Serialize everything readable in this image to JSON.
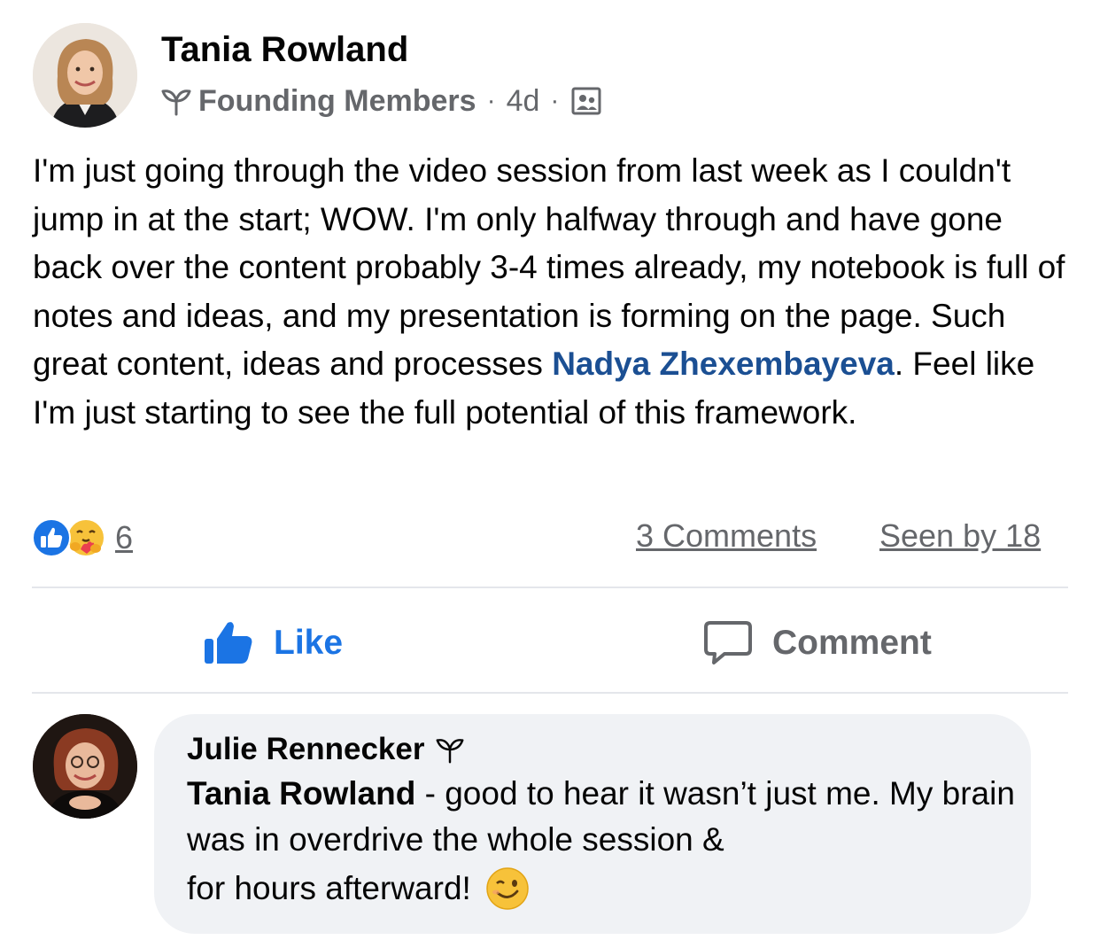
{
  "post": {
    "author": "Tania Rowland",
    "group": "Founding Members",
    "separator": "·",
    "time": "4d",
    "body_line1": "I'm just going through the video session from last week as I couldn't jump in at the start; WOW. I'm only halfway through and have gone back over the content probably 3-4 times already, my notebook is full of notes and ideas, and my presentation is forming on the page. Such great content, ideas and processes ",
    "mention": "Nadya Zhexembayeva",
    "body_line2": ". Feel like I'm just starting to see the full potential of this framework.",
    "reaction_count": "6",
    "comments_link": "3 Comments",
    "seen_by": "Seen by 18",
    "icons": {
      "group_badge": "sprout-icon",
      "audience": "members-icon",
      "like_reaction": "like-reaction-icon",
      "care_reaction": "care-reaction-icon"
    }
  },
  "actions": {
    "like_label": "Like",
    "comment_label": "Comment"
  },
  "comment": {
    "author": "Julie Rennecker",
    "reference": "Tania Rowland",
    "text_part1": " - good to hear it wasn’t just me. My brain was in overdrive the whole session &",
    "text_part2": "for hours afterward!",
    "emoji": "winking-face-emoji"
  },
  "colors": {
    "mention": "#1b4f93",
    "like_active": "#1b74e4",
    "secondary_text": "#65676b",
    "comment_bg": "#f0f2f5",
    "divider": "#e4e6eb"
  }
}
